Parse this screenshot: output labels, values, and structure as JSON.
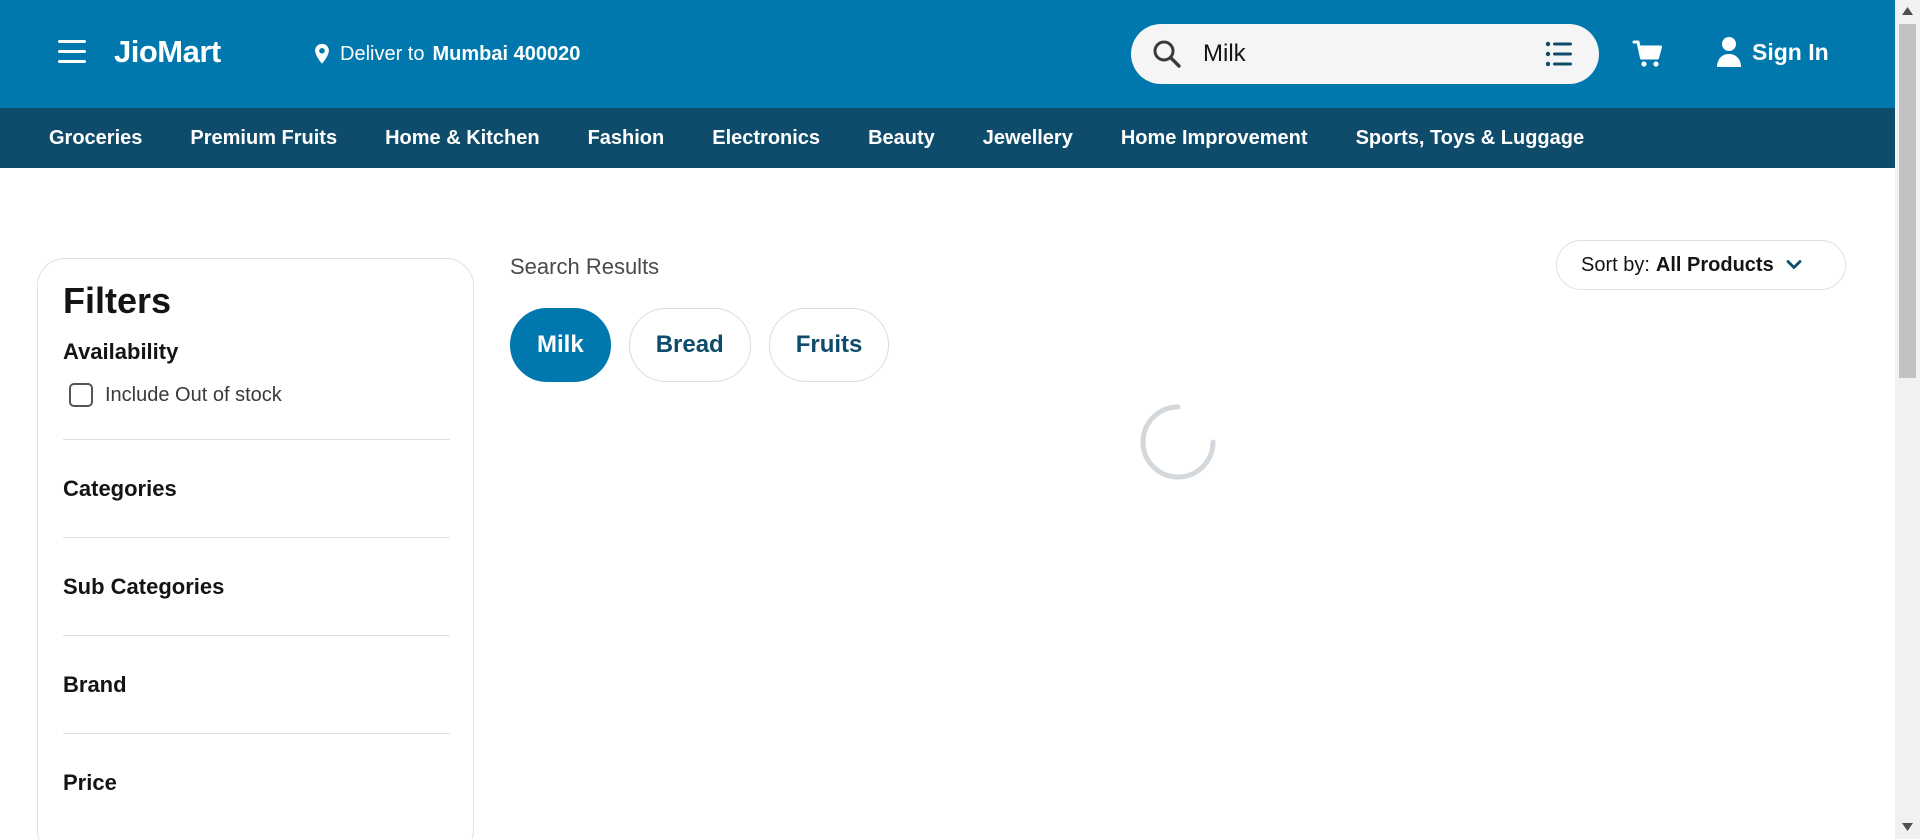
{
  "header": {
    "logo": "JioMart",
    "deliver_prefix": "Deliver to",
    "deliver_location": "Mumbai 400020",
    "search_value": "Milk",
    "signin_label": "Sign In"
  },
  "categories": [
    "Groceries",
    "Premium Fruits",
    "Home & Kitchen",
    "Fashion",
    "Electronics",
    "Beauty",
    "Jewellery",
    "Home Improvement",
    "Sports, Toys & Luggage"
  ],
  "filters": {
    "title": "Filters",
    "availability_label": "Availability",
    "include_oos_label": "Include Out of stock",
    "include_oos_checked": false,
    "sections": [
      "Categories",
      "Sub Categories",
      "Brand",
      "Price"
    ]
  },
  "main": {
    "results_title": "Search Results",
    "sort_prefix": "Sort by:",
    "sort_value": "All Products",
    "chips": [
      {
        "label": "Milk",
        "active": true
      },
      {
        "label": "Bread",
        "active": false
      },
      {
        "label": "Fruits",
        "active": false
      }
    ]
  },
  "colors": {
    "brand_blue": "#0078ad",
    "nav_dark": "#0f4c6b"
  },
  "icons": [
    "menu-icon",
    "location-pin-icon",
    "search-icon",
    "list-icon",
    "cart-icon",
    "user-icon",
    "chevron-down-icon",
    "loading-spinner-icon"
  ]
}
